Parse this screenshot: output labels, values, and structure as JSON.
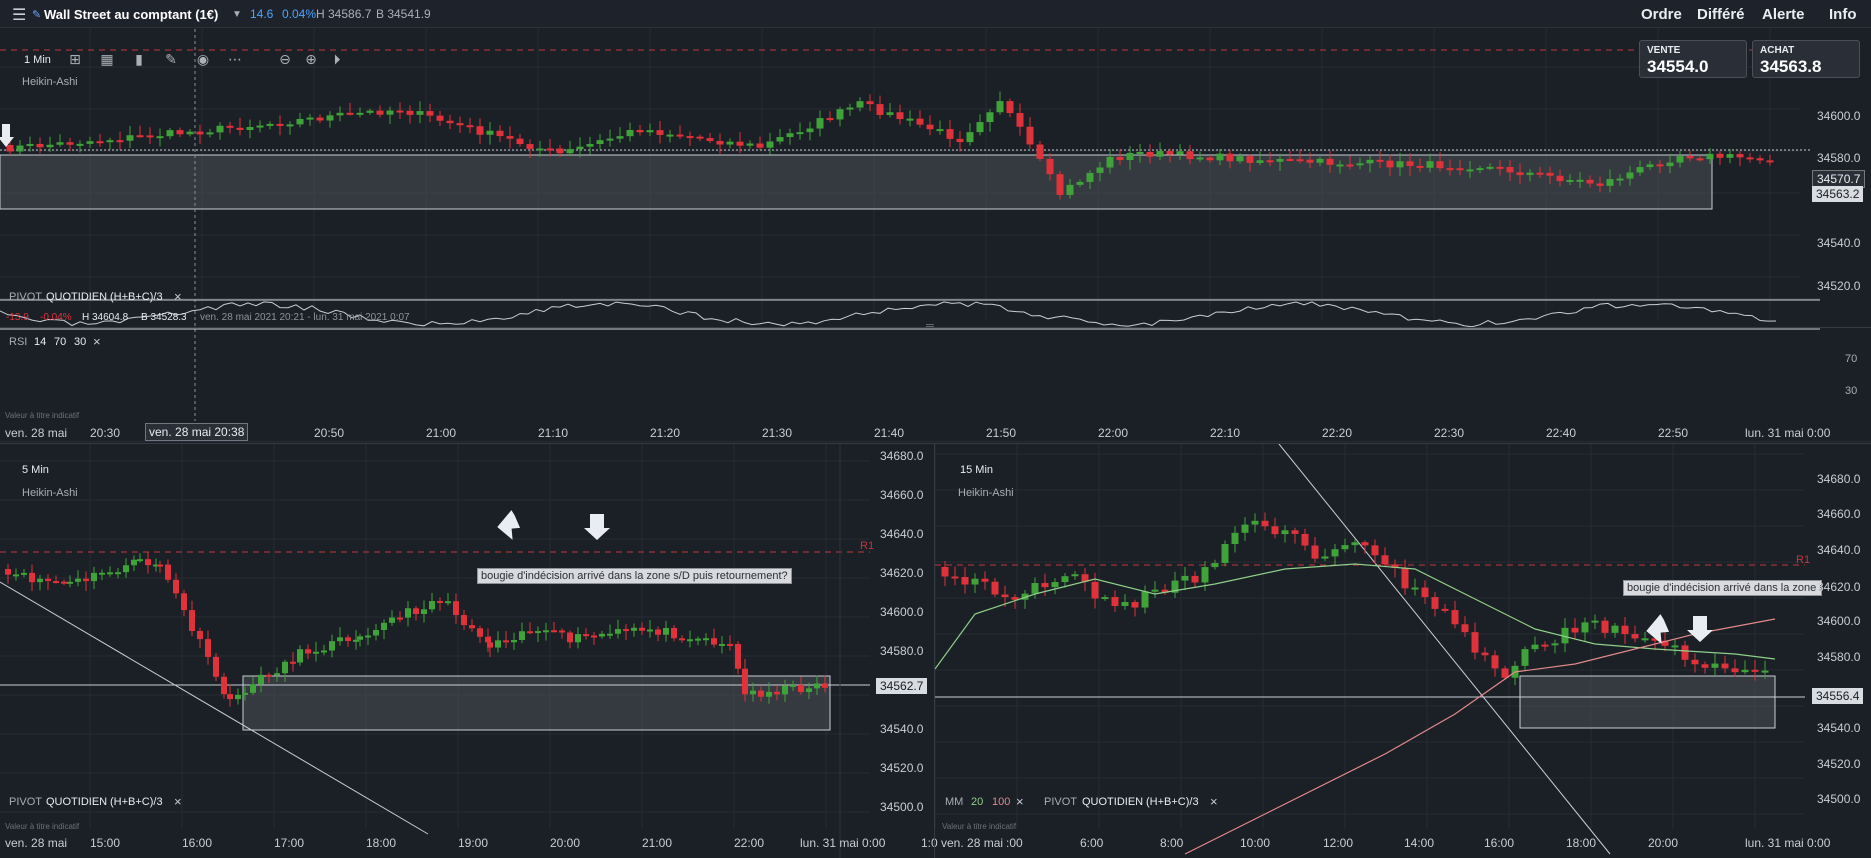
{
  "topbar": {
    "instrument": "Wall Street au comptant (1€)",
    "change": "14.6",
    "change_pct": "0.04%",
    "high": "H 34586.7",
    "low": "B 34541.9",
    "menu": [
      "Ordre",
      "Différé",
      "Alerte",
      "Info"
    ]
  },
  "quotes": {
    "sell_label": "VENTE",
    "sell_value": "34554.0",
    "buy_label": "ACHAT",
    "buy_value": "34563.8"
  },
  "colors": {
    "up": "#3fa33a",
    "down": "#e0323a",
    "background": "#1b1f26",
    "grid": "#272c34",
    "pivot_line": "#c0383e",
    "zone_fill": "#4a4e55",
    "ma20": "#8fd08a",
    "ma100": "#e08a8a"
  },
  "chart1": {
    "timeframe": "1 Min",
    "style": "Heikin-Ashi",
    "pivot_label": "PIVOT",
    "pivot_name": "QUOTIDIEN",
    "pivot_formula": "(H+B+C)/3",
    "stats": {
      "change": "-13.9",
      "change_pct": "-0.04%",
      "high": "H 34604.8",
      "low": "B 34528.3",
      "range": "ven. 28 mai 2021 20:21 - lun. 31 mai 2021 0:07"
    },
    "price_ticks": [
      "34600.0",
      "34580.0",
      "34560.0",
      "34540.0",
      "34520.0"
    ],
    "price_label_main": "34570.7",
    "price_label_secondary": "34563.2",
    "time_ticks": [
      "ven. 28 mai",
      "20:30",
      "20:50",
      "21:00",
      "21:10",
      "21:20",
      "21:30",
      "21:40",
      "21:50",
      "22:00",
      "22:10",
      "22:20",
      "22:30",
      "22:40",
      "22:50",
      "lun. 31 mai 0:00"
    ],
    "crosshair_time": "ven. 28 mai 20:38",
    "rsi": {
      "label": "RSI",
      "period": "14",
      "upper": "70",
      "lower": "30"
    },
    "disclaimer": "Valeur à titre indicatif"
  },
  "chart2": {
    "timeframe": "5 Min",
    "style": "Heikin-Ashi",
    "pivot_label": "PIVOT",
    "pivot_name": "QUOTIDIEN",
    "pivot_formula": "(H+B+C)/3",
    "r1": "R1",
    "price_ticks": [
      "34680.0",
      "34660.0",
      "34640.0",
      "34620.0",
      "34600.0",
      "34580.0",
      "34560.0",
      "34540.0",
      "34520.0",
      "34500.0"
    ],
    "price_label": "34562.7",
    "time_ticks": [
      "ven. 28 mai",
      "15:00",
      "16:00",
      "17:00",
      "18:00",
      "19:00",
      "20:00",
      "21:00",
      "22:00",
      "lun. 31 mai 0:00",
      "1:0"
    ],
    "annotation": "bougie d'indécision arrivé dans la zone s/D puis retournement?",
    "disclaimer": "Valeur à titre indicatif"
  },
  "chart3": {
    "timeframe": "15 Min",
    "style": "Heikin-Ashi",
    "ma_label": "MM",
    "ma_fast": "20",
    "ma_slow": "100",
    "pivot_label": "PIVOT",
    "pivot_name": "QUOTIDIEN",
    "pivot_formula": "(H+B+C)/3",
    "r1": "R1",
    "price_ticks": [
      "34680.0",
      "34660.0",
      "34640.0",
      "34620.0",
      "34600.0",
      "34580.0",
      "34560.0",
      "34540.0",
      "34520.0",
      "34500.0"
    ],
    "price_label": "34556.4",
    "price_label_top": "34620.0",
    "time_ticks": [
      "ven. 28 mai",
      ":00",
      "6:00",
      "8:00",
      "10:00",
      "12:00",
      "14:00",
      "16:00",
      "18:00",
      "20:00",
      "lun. 31 mai 0:00"
    ],
    "annotation": "bougie d'indécision arrivé dans la zone s/D puis retournement?",
    "disclaimer": "Valeur à titre indicatif"
  },
  "icons": [
    "hamburger-icon",
    "tag-icon",
    "dropdown-icon",
    "crosshair-icon",
    "layout-icon",
    "indicator-icon",
    "pencil-icon",
    "eye-icon",
    "more-icon",
    "zoom-out-icon",
    "zoom-in-icon",
    "jump-end-icon",
    "close-icon"
  ]
}
